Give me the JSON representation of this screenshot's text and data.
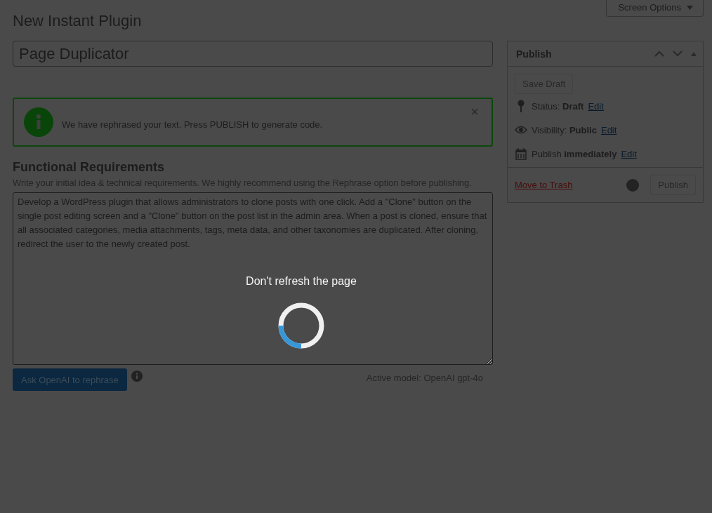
{
  "page_title": "New Instant Plugin",
  "screen_options": {
    "label": "Screen Options"
  },
  "title_field": {
    "value": "Page Duplicator"
  },
  "notice": {
    "message": "We have rephrased your text. Press PUBLISH to generate code.",
    "dismiss": "×"
  },
  "requirements": {
    "heading": "Functional Requirements",
    "description": "Write your initial idea & technical requirements. We highly recommend using the Rephrase option before publishing.",
    "value": "Develop a WordPress plugin that allows administrators to clone posts with one click. Add a \"Clone\" button on the single post editing screen and a \"Clone\" button on the post list in the admin area. When a post is cloned, ensure that all associated categories, media attachments, tags, meta data, and other taxonomies are duplicated. After cloning, redirect the user to the newly created post."
  },
  "rephrase_button": {
    "label": "Ask OpenAI to rephrase"
  },
  "active_model": "Active model: OpenAI gpt-4o",
  "publish_box": {
    "title": "Publish",
    "save_draft": {
      "label": "Save Draft",
      "disabled": true
    },
    "meta": [
      {
        "kind": "status",
        "label": "Status:",
        "value": "Draft",
        "link": "Edit"
      },
      {
        "kind": "visibility",
        "label": "Visibility:",
        "value": "Public",
        "link": "Edit"
      },
      {
        "kind": "schedule",
        "label": "Publish",
        "value": "immediately",
        "link": "Edit"
      }
    ],
    "trash": "Move to Trash",
    "publish": {
      "label": "Publish",
      "disabled": true
    }
  },
  "loading": {
    "message": "Don't refresh the page"
  }
}
